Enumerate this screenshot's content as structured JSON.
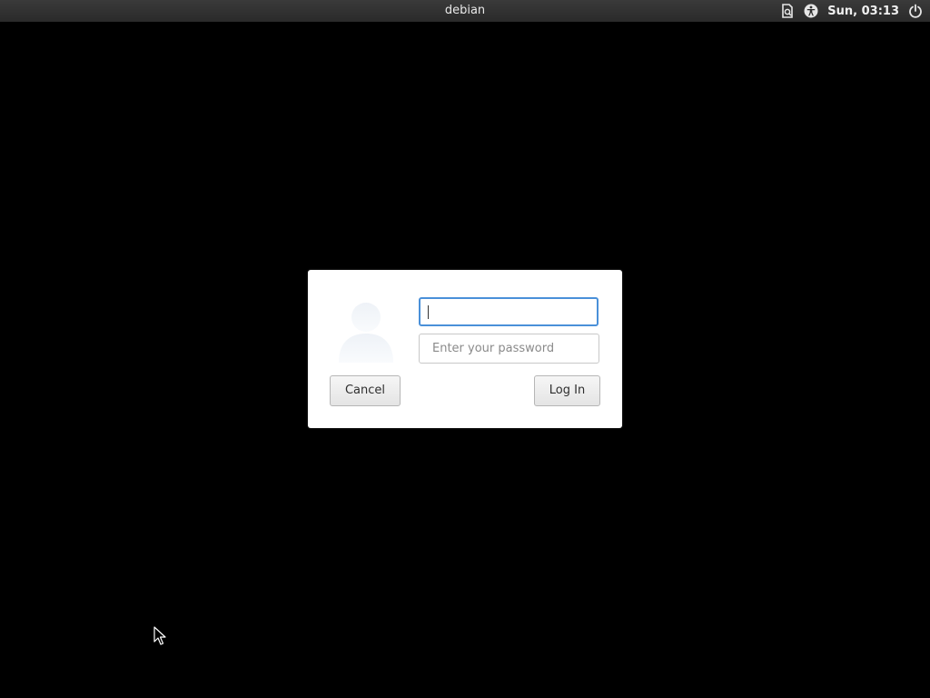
{
  "topbar": {
    "hostname": "debian",
    "clock": "Sun, 03:13",
    "icons": [
      "document-icon",
      "accessibility-icon",
      "power-icon"
    ]
  },
  "login_dialog": {
    "username": {
      "value": "",
      "placeholder": ""
    },
    "password": {
      "value": "",
      "placeholder": "Enter your password"
    },
    "cancel_label": "Cancel",
    "login_label": "Log In"
  },
  "colors": {
    "background": "#000000",
    "topbar": "#2e2e2e",
    "focus_border": "#4a90d9",
    "dialog": "#ffffff"
  }
}
